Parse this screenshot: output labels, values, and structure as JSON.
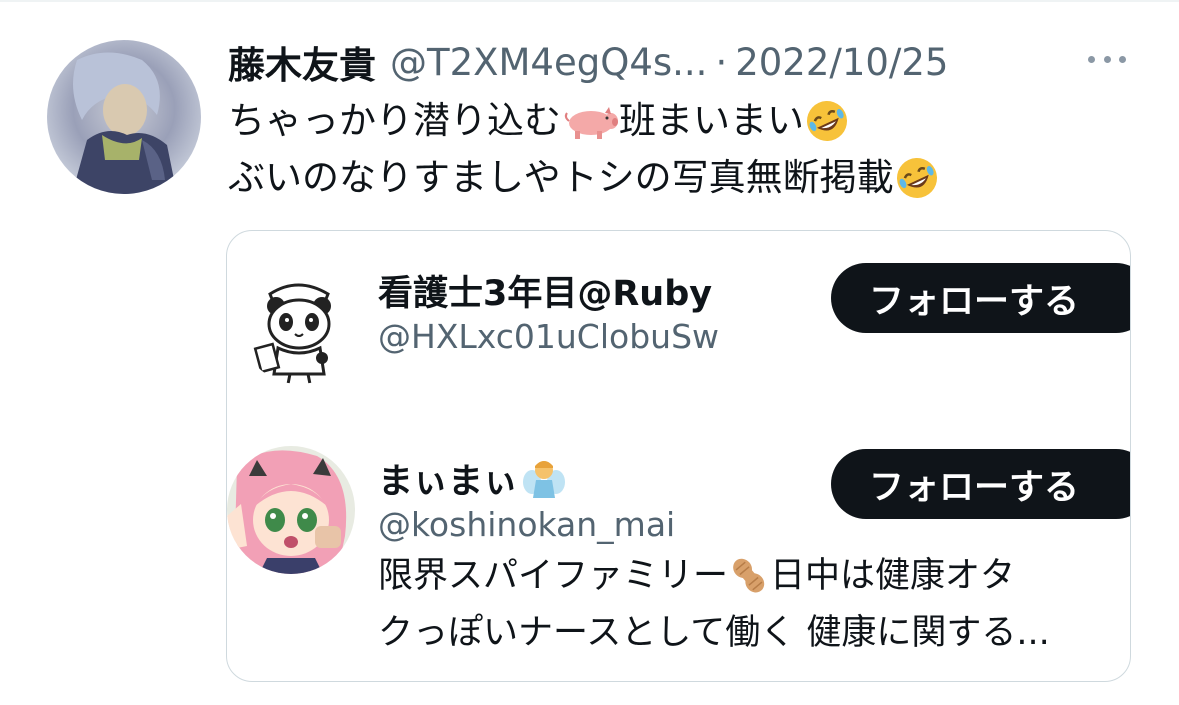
{
  "tweet": {
    "author_name": "藤木友貴",
    "author_handle": "@T2XM4egQ4s...",
    "separator": "·",
    "date": "2022/10/25",
    "line1_part1": "ちゃっかり潜り込む",
    "line1_part2": "班まいまい",
    "line2": "ぶいのなりすましやトシの写真無断掲載"
  },
  "card": {
    "users": [
      {
        "name": "看護士3年目@Ruby",
        "handle": "@HXLxc01uClobuSw",
        "follow_label": "フォローする"
      },
      {
        "name": "まぃまぃ",
        "handle": "@koshinokan_mai",
        "follow_label": "フォローする",
        "bio_line1_part1": "限界スパイファミリー ",
        "bio_line1_part2": "日中は健康オタ",
        "bio_line2": "クっぽいナースとして働く 健康に関する..."
      }
    ]
  },
  "icons": {
    "more": "more-icon",
    "pig": "pig-emoji-icon",
    "laughing": "rofl-emoji-icon",
    "fairy": "fairy-emoji-icon",
    "peanut": "peanut-emoji-icon"
  },
  "colors": {
    "text": "#0f1419",
    "secondary": "#536471",
    "border": "#cfd9de",
    "button": "#0f1419"
  }
}
